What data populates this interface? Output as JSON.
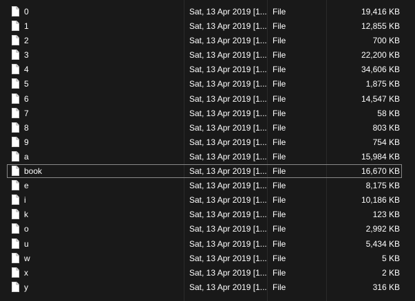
{
  "files": [
    {
      "name": "0",
      "date": "Sat, 13 Apr 2019 [1...",
      "type": "File",
      "size": "19,416 KB"
    },
    {
      "name": "1",
      "date": "Sat, 13 Apr 2019 [1...",
      "type": "File",
      "size": "12,855 KB"
    },
    {
      "name": "2",
      "date": "Sat, 13 Apr 2019 [1...",
      "type": "File",
      "size": "700 KB"
    },
    {
      "name": "3",
      "date": "Sat, 13 Apr 2019 [1...",
      "type": "File",
      "size": "22,200 KB"
    },
    {
      "name": "4",
      "date": "Sat, 13 Apr 2019 [1...",
      "type": "File",
      "size": "34,606 KB"
    },
    {
      "name": "5",
      "date": "Sat, 13 Apr 2019 [1...",
      "type": "File",
      "size": "1,875 KB"
    },
    {
      "name": "6",
      "date": "Sat, 13 Apr 2019 [1...",
      "type": "File",
      "size": "14,547 KB"
    },
    {
      "name": "7",
      "date": "Sat, 13 Apr 2019 [1...",
      "type": "File",
      "size": "58 KB"
    },
    {
      "name": "8",
      "date": "Sat, 13 Apr 2019 [1...",
      "type": "File",
      "size": "803 KB"
    },
    {
      "name": "9",
      "date": "Sat, 13 Apr 2019 [1...",
      "type": "File",
      "size": "754 KB"
    },
    {
      "name": "a",
      "date": "Sat, 13 Apr 2019 [1...",
      "type": "File",
      "size": "15,984 KB"
    },
    {
      "name": "book",
      "date": "Sat, 13 Apr 2019 [1...",
      "type": "File",
      "size": "16,670 KB",
      "selected": true
    },
    {
      "name": "e",
      "date": "Sat, 13 Apr 2019 [1...",
      "type": "File",
      "size": "8,175 KB"
    },
    {
      "name": "i",
      "date": "Sat, 13 Apr 2019 [1...",
      "type": "File",
      "size": "10,186 KB"
    },
    {
      "name": "k",
      "date": "Sat, 13 Apr 2019 [1...",
      "type": "File",
      "size": "123 KB"
    },
    {
      "name": "o",
      "date": "Sat, 13 Apr 2019 [1...",
      "type": "File",
      "size": "2,992 KB"
    },
    {
      "name": "u",
      "date": "Sat, 13 Apr 2019 [1...",
      "type": "File",
      "size": "5,434 KB"
    },
    {
      "name": "w",
      "date": "Sat, 13 Apr 2019 [1...",
      "type": "File",
      "size": "5 KB"
    },
    {
      "name": "x",
      "date": "Sat, 13 Apr 2019 [1...",
      "type": "File",
      "size": "2 KB"
    },
    {
      "name": "y",
      "date": "Sat, 13 Apr 2019 [1...",
      "type": "File",
      "size": "316 KB"
    }
  ],
  "icons": {
    "file": "file-icon"
  },
  "colors": {
    "background": "#191919",
    "text": "#ffffff",
    "selection_border": "#8a8a8a"
  }
}
